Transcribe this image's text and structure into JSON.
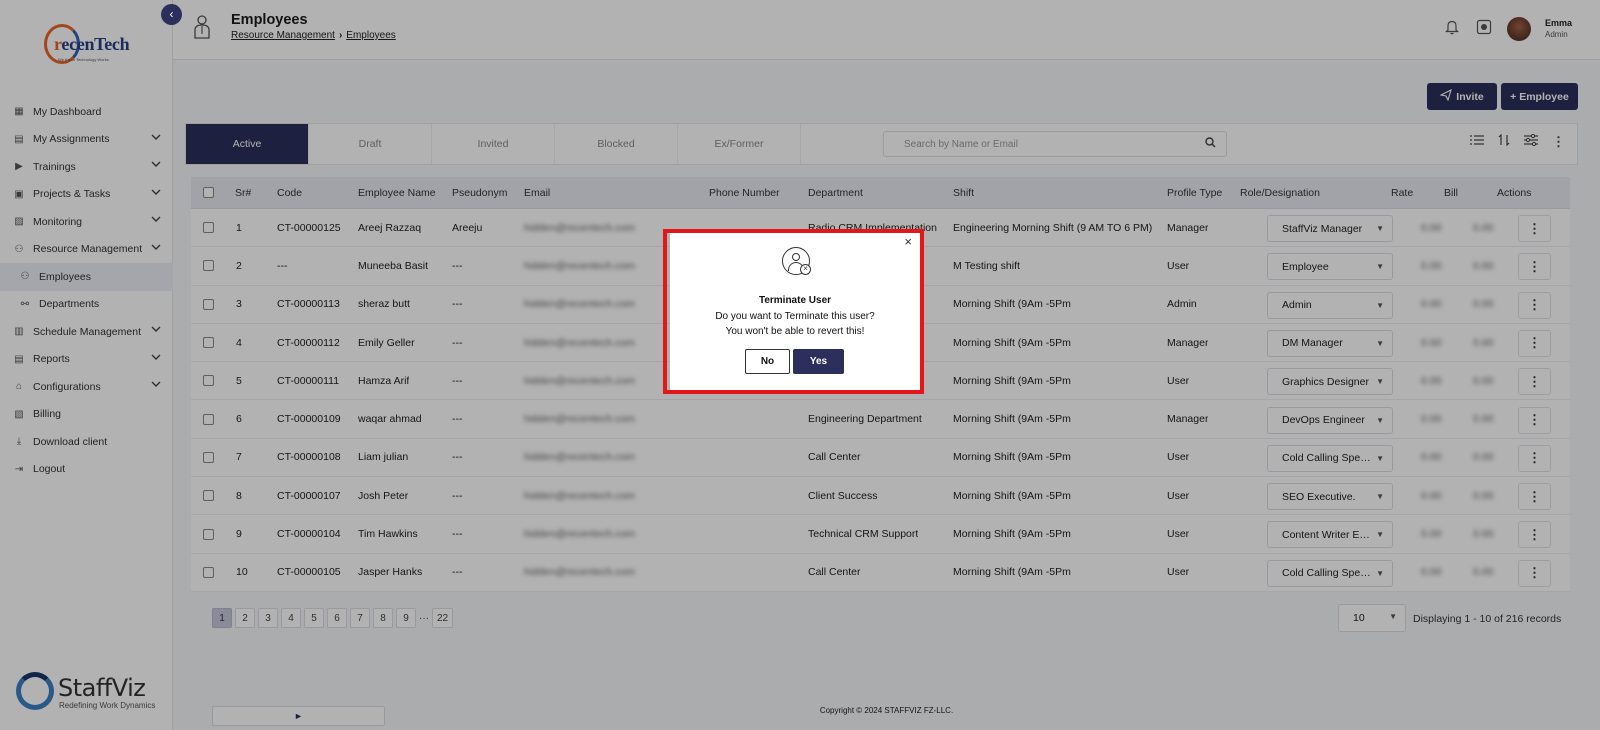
{
  "brand": {
    "logo_pre": "r",
    "logo_main": "ecenTech",
    "logo_tagline": "We Know Technology Works",
    "footer_logo": "StaffViz",
    "footer_tagline": "Redefining Work Dynamics"
  },
  "sidebar": {
    "items": [
      {
        "label": "My Dashboard",
        "icon": "dashboard-icon",
        "chevron": false
      },
      {
        "label": "My Assignments",
        "icon": "assignments-icon",
        "chevron": true
      },
      {
        "label": "Trainings",
        "icon": "trainings-icon",
        "chevron": true
      },
      {
        "label": "Projects & Tasks",
        "icon": "projects-icon",
        "chevron": true
      },
      {
        "label": "Monitoring",
        "icon": "monitoring-icon",
        "chevron": true
      },
      {
        "label": "Resource Management",
        "icon": "resource-icon",
        "chevron": true
      },
      {
        "label": "Employees",
        "icon": "employees-icon",
        "chevron": false,
        "sub": true,
        "active": true
      },
      {
        "label": "Departments",
        "icon": "departments-icon",
        "chevron": false,
        "sub": true
      },
      {
        "label": "Schedule Management",
        "icon": "schedule-icon",
        "chevron": true
      },
      {
        "label": "Reports",
        "icon": "reports-icon",
        "chevron": true
      },
      {
        "label": "Configurations",
        "icon": "configurations-icon",
        "chevron": true
      },
      {
        "label": "Billing",
        "icon": "billing-icon",
        "chevron": false
      },
      {
        "label": "Download client",
        "icon": "download-icon",
        "chevron": false
      },
      {
        "label": "Logout",
        "icon": "logout-icon",
        "chevron": false
      }
    ]
  },
  "header": {
    "title": "Employees",
    "breadcrumb": [
      "Resource Management",
      "Employees"
    ],
    "user_name": "Emma",
    "user_role": "Admin"
  },
  "actions": {
    "invite": "Invite",
    "employee": "+ Employee"
  },
  "tabs": [
    "Active",
    "Draft",
    "Invited",
    "Blocked",
    "Ex/Former"
  ],
  "search": {
    "placeholder": "Search by Name or Email"
  },
  "table": {
    "columns": [
      "Sr#",
      "Code",
      "Employee Name",
      "Pseudonym",
      "Email",
      "Phone Number",
      "Department",
      "Shift",
      "Profile Type",
      "Role/Designation",
      "Rate",
      "Bill",
      "Actions"
    ],
    "rows": [
      {
        "sr": "1",
        "code": "CT-00000125",
        "name": "Areej Razzaq",
        "pseudonym": "Areeju",
        "email": "hidden@recentech.com",
        "phone": "",
        "department": "Radio CRM Implementation",
        "shift": "Engineering Morning Shift (9 AM TO 6 PM)",
        "profile": "Manager",
        "role": "StaffViz Manager",
        "rate": "0.00",
        "bill": "0.00"
      },
      {
        "sr": "2",
        "code": "---",
        "name": "Muneeba Basit",
        "pseudonym": "---",
        "email": "hidden@recentech.com",
        "phone": "",
        "department": "",
        "shift": "M Testing shift",
        "profile": "User",
        "role": "Employee",
        "rate": "0.00",
        "bill": "0.00"
      },
      {
        "sr": "3",
        "code": "CT-00000113",
        "name": "sheraz butt",
        "pseudonym": "---",
        "email": "hidden@recentech.com",
        "phone": "",
        "department": "",
        "shift": "Morning Shift (9Am -5Pm",
        "profile": "Admin",
        "role": "Admin",
        "rate": "0.00",
        "bill": "0.00"
      },
      {
        "sr": "4",
        "code": "CT-00000112",
        "name": "Emily Geller",
        "pseudonym": "---",
        "email": "hidden@recentech.com",
        "phone": "",
        "department": "",
        "shift": "Morning Shift (9Am -5Pm",
        "profile": "Manager",
        "role": "DM Manager",
        "rate": "0.00",
        "bill": "0.00"
      },
      {
        "sr": "5",
        "code": "CT-00000111",
        "name": "Hamza Arif",
        "pseudonym": "---",
        "email": "hidden@recentech.com",
        "phone": "",
        "department": "",
        "shift": "Morning Shift (9Am -5Pm",
        "profile": "User",
        "role": "Graphics Designer",
        "rate": "0.00",
        "bill": "0.00"
      },
      {
        "sr": "6",
        "code": "CT-00000109",
        "name": "waqar ahmad",
        "pseudonym": "---",
        "email": "hidden@recentech.com",
        "phone": "",
        "department": "Engineering Department",
        "shift": "Morning Shift (9Am -5Pm",
        "profile": "Manager",
        "role": "DevOps Engineer",
        "rate": "0.00",
        "bill": "0.00"
      },
      {
        "sr": "7",
        "code": "CT-00000108",
        "name": "Liam julian",
        "pseudonym": "---",
        "email": "hidden@recentech.com",
        "phone": "",
        "department": "Call Center",
        "shift": "Morning Shift (9Am -5Pm",
        "profile": "User",
        "role": "Cold Calling Speci...",
        "rate": "0.00",
        "bill": "0.00"
      },
      {
        "sr": "8",
        "code": "CT-00000107",
        "name": "Josh Peter",
        "pseudonym": "---",
        "email": "hidden@recentech.com",
        "phone": "",
        "department": "Client Success",
        "shift": "Morning Shift (9Am -5Pm",
        "profile": "User",
        "role": "SEO Executive.",
        "rate": "0.00",
        "bill": "0.00"
      },
      {
        "sr": "9",
        "code": "CT-00000104",
        "name": "Tim Hawkins",
        "pseudonym": "---",
        "email": "hidden@recentech.com",
        "phone": "",
        "department": "Technical CRM Support",
        "shift": "Morning Shift (9Am -5Pm",
        "profile": "User",
        "role": "Content Writer Exe...",
        "rate": "0.00",
        "bill": "0.00"
      },
      {
        "sr": "10",
        "code": "CT-00000105",
        "name": "Jasper Hanks",
        "pseudonym": "---",
        "email": "hidden@recentech.com",
        "phone": "",
        "department": "Call Center",
        "shift": "Morning Shift (9Am -5Pm",
        "profile": "User",
        "role": "Cold Calling Speci...",
        "rate": "0.00",
        "bill": "0.00"
      }
    ]
  },
  "pagination": {
    "prev": "◄",
    "next": "►",
    "pages": [
      "1",
      "2",
      "3",
      "4",
      "5",
      "6",
      "7",
      "8",
      "9"
    ],
    "ellipsis": "···",
    "last": "22",
    "current": "1",
    "per_page": "10",
    "records": "Displaying 1 - 10 of 216 records"
  },
  "footer": "Copyright © 2024 STAFFVIZ FZ-LLC.",
  "modal": {
    "title": "Terminate User",
    "line1": "Do you want to Terminate this user?",
    "line2": "You won't be able to revert this!",
    "no": "No",
    "yes": "Yes",
    "close": "×"
  },
  "colors": {
    "primary": "#2c2f5b",
    "highlight": "#e3161b",
    "accent_orange": "#e8662a"
  }
}
